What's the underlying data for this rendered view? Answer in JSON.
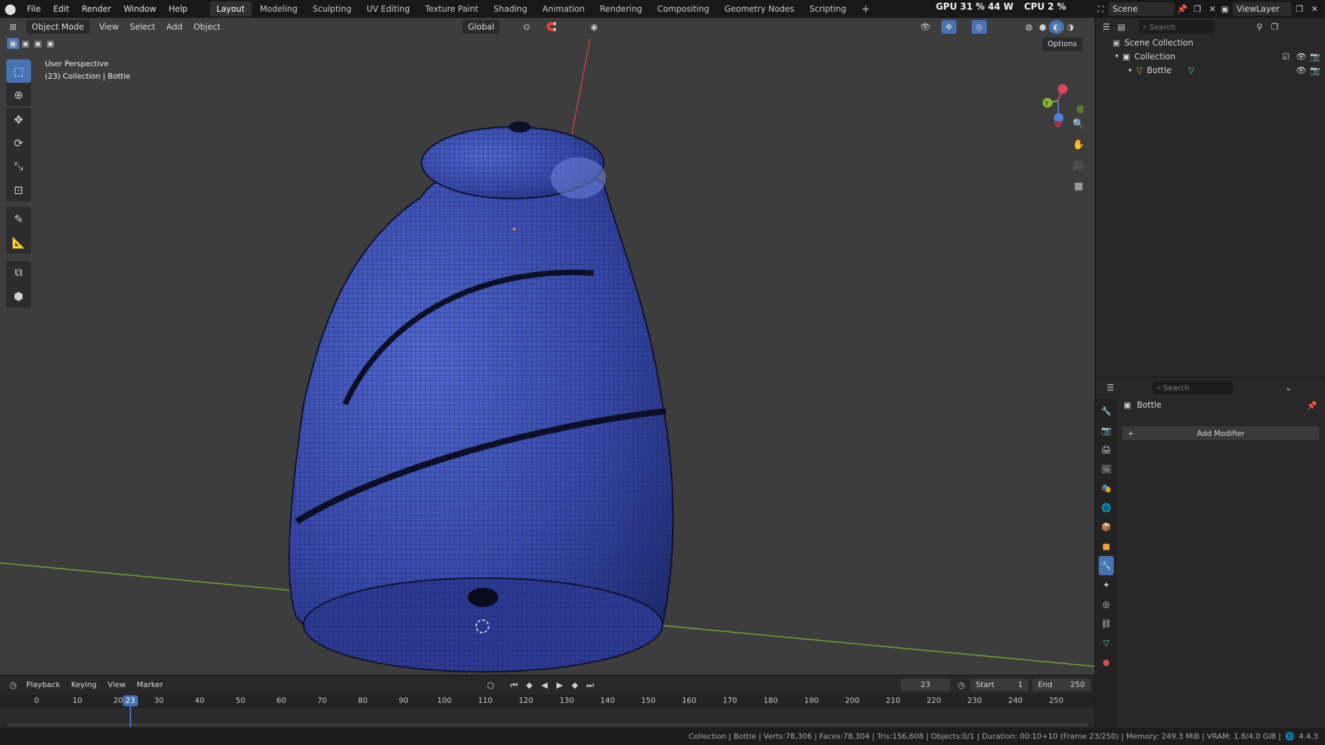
{
  "menu": [
    "File",
    "Edit",
    "Render",
    "Window",
    "Help"
  ],
  "workspaces": [
    {
      "label": "Layout",
      "active": true
    },
    {
      "label": "Modeling"
    },
    {
      "label": "Sculpting"
    },
    {
      "label": "UV Editing"
    },
    {
      "label": "Texture Paint"
    },
    {
      "label": "Shading"
    },
    {
      "label": "Animation"
    },
    {
      "label": "Rendering"
    },
    {
      "label": "Compositing"
    },
    {
      "label": "Geometry Nodes"
    },
    {
      "label": "Scripting"
    }
  ],
  "add_workspace": "+",
  "stats_overlay": {
    "gpu": "GPU  31 %  44 W",
    "cpu": "CPU  2 %"
  },
  "scene": {
    "label": "Scene",
    "viewlayer": "ViewLayer"
  },
  "viewport_header": {
    "mode": "Object Mode",
    "menus": [
      "View",
      "Select",
      "Add",
      "Object"
    ],
    "orientation": "Global",
    "options": "Options"
  },
  "viewport_info": {
    "perspective": "User Perspective",
    "collection": "(23) Collection | Bottle"
  },
  "gizmo": {
    "y_label": "Y",
    "x_color": "#e0465a",
    "y_color": "#8bb833",
    "z_color": "#4f7fd6"
  },
  "outliner": {
    "search_placeholder": "Search",
    "scene_collection": "Scene Collection",
    "collection": "Collection",
    "object": "Bottle"
  },
  "properties": {
    "search_placeholder": "Search",
    "object_name": "Bottle",
    "add_modifier": "Add Modifier"
  },
  "timeline": {
    "menus": [
      "Playback",
      "Keying",
      "View",
      "Marker"
    ],
    "current_frame": "23",
    "start_label": "Start",
    "start_value": "1",
    "end_label": "End",
    "end_value": "250",
    "ruler": [
      "0",
      "10",
      "20",
      "30",
      "40",
      "50",
      "60",
      "70",
      "80",
      "90",
      "100",
      "110",
      "120",
      "130",
      "140",
      "150",
      "160",
      "170",
      "180",
      "190",
      "200",
      "210",
      "220",
      "230",
      "240",
      "250"
    ],
    "playhead_label": "23"
  },
  "statusbar": {
    "text": "Collection | Bottle | Verts:78,306 | Faces:78,304 | Tris:156,608 | Objects:0/1 | Duration: 00:10+10 (Frame 23/250) | Memory: 249.3 MiB | VRAM: 1.8/4.0 GiB |",
    "version": "4.4.3"
  },
  "colors": {
    "accent": "#4772b3",
    "bottle": "#3648a8",
    "viewport_bg": "#3d3d3d",
    "axis_x": "#c8434e",
    "axis_y": "#7da534"
  }
}
